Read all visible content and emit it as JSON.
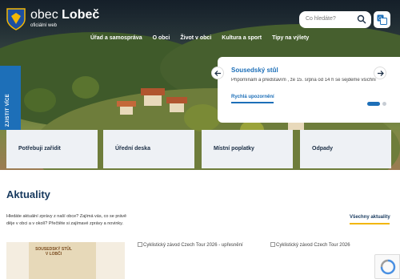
{
  "header": {
    "brand_prefix": "obec",
    "brand_name": "Lobeč",
    "brand_sub": "oficiální web",
    "search_placeholder": "Co hledáte?"
  },
  "nav": {
    "items": [
      "Úřad a samospráva",
      "O obci",
      "Život v obci",
      "Kultura a sport",
      "Tipy na výlety"
    ]
  },
  "side_tab": {
    "label": "ZJISTIT VÍCE"
  },
  "news_slider": {
    "title": "Sousedský stůl",
    "text": "Připomínám a představím , že 15. srpna od 14 h se sejdeme všichni",
    "link": "Rychlá upozornění",
    "active_index": 1,
    "slides": 2
  },
  "tiles": [
    "Potřebuji zařídit",
    "Úřední deska",
    "Místní poplatky",
    "Odpady"
  ],
  "aktuality": {
    "title": "Aktuality",
    "intro": "Hledáte aktuální zprávy z naší obce? Zajímá vás, co se právě děje v obci a v okolí? Přečtěte si zajímavé zprávy a novinky.",
    "all_link": "Všechny aktuality",
    "cards": [
      {
        "poster_title": "SOUSEDSKÝ STŮL V LOBČI"
      },
      {
        "alt": "Cyklistický závod Czech Tour 2026 - upřesnění"
      },
      {
        "alt": "Cyklistický závod Czech Tour 2026"
      }
    ]
  },
  "colors": {
    "accent": "#1d6fb8",
    "navy": "#17395e",
    "yellow": "#f2b705",
    "tile_bg": "#eef1f5"
  }
}
